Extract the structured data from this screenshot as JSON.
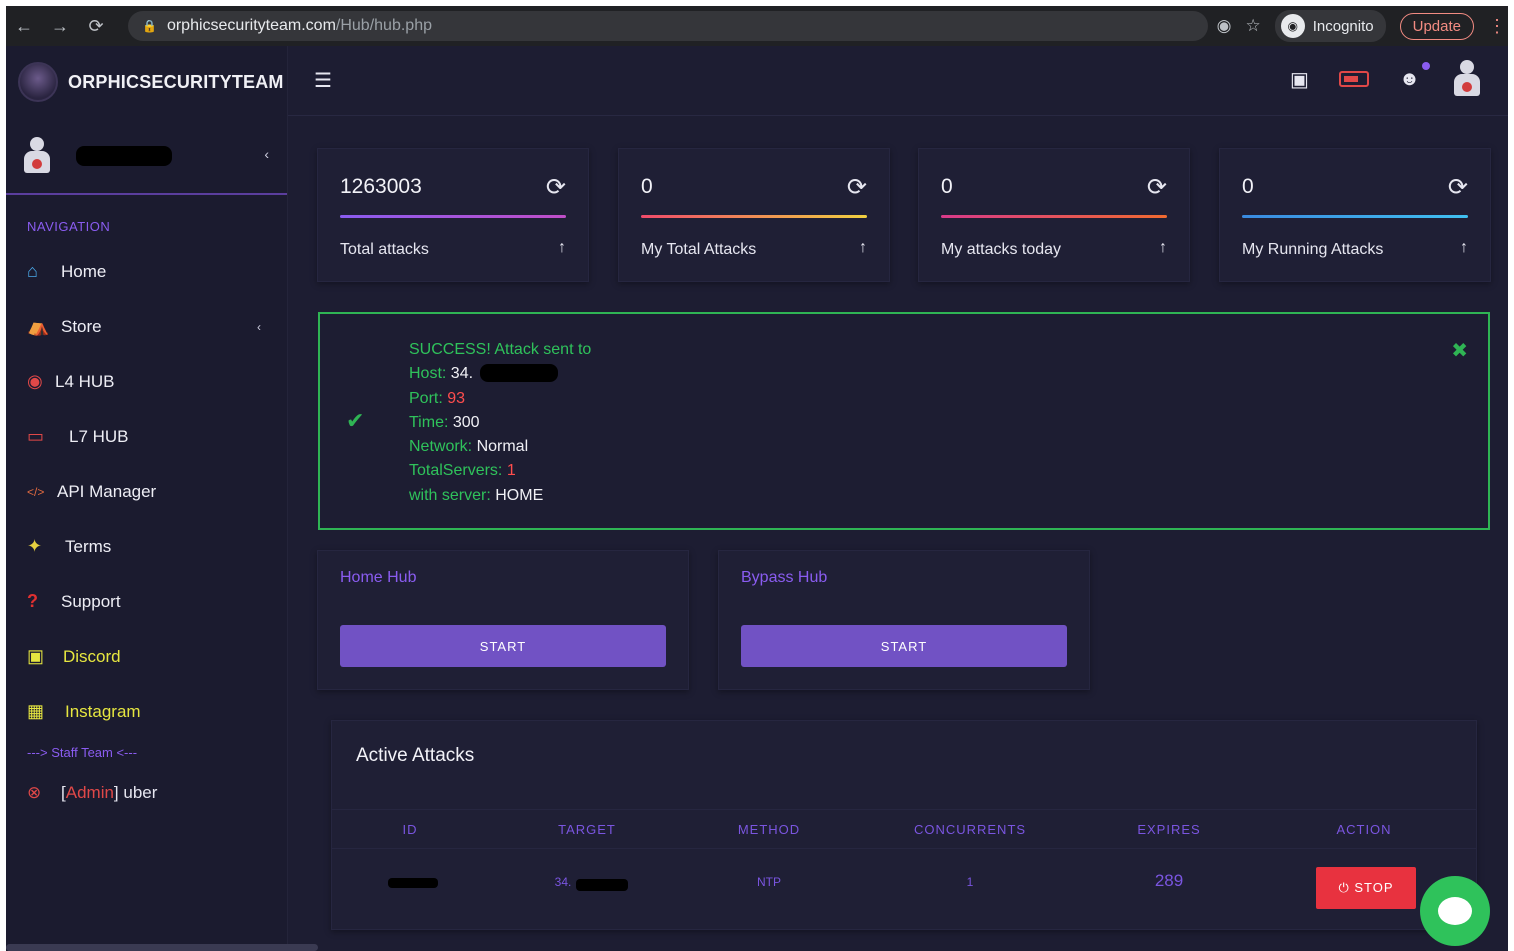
{
  "browser": {
    "url_host": "orphicsecurityteam.com",
    "url_path": "/Hub/hub.php",
    "profile_label": "Incognito",
    "update_label": "Update"
  },
  "brand": {
    "name": "ORPHICSECURITYTEAM"
  },
  "sidebar": {
    "nav_title": "NAVIGATION",
    "items": [
      {
        "label": "Home",
        "icon": "home-icon",
        "color": "#eeeef5"
      },
      {
        "label": "Store",
        "icon": "basket-icon",
        "color": "#eeeef5"
      },
      {
        "label": "L4 HUB",
        "icon": "fire-icon",
        "color": "#eeeef5"
      },
      {
        "label": "L7 HUB",
        "icon": "battery-icon",
        "color": "#eeeef5"
      },
      {
        "label": "API Manager",
        "icon": "code-icon",
        "color": "#eeeef5"
      },
      {
        "label": "Terms",
        "icon": "magic-icon",
        "color": "#eeeef5"
      },
      {
        "label": "Support",
        "icon": "question-icon",
        "color": "#eeeef5"
      },
      {
        "label": "Discord",
        "icon": "discord-icon",
        "color": "#e6e640"
      },
      {
        "label": "Instagram",
        "icon": "gift-icon",
        "color": "#e6e640"
      }
    ],
    "staff_title": "---> Staff Team <---",
    "admin": {
      "tag": "Admin",
      "name": " uber"
    }
  },
  "stats": [
    {
      "value": "1263003",
      "label": "Total attacks",
      "bar": "linear-gradient(90deg,#8a5cf0,#c04ec8)"
    },
    {
      "value": "0",
      "label": "My Total Attacks",
      "bar": "linear-gradient(90deg,#f04a6a,#f0d040)"
    },
    {
      "value": "0",
      "label": "My attacks today",
      "bar": "linear-gradient(90deg,#d83a8a,#f06a30)"
    },
    {
      "value": "0",
      "label": "My Running Attacks",
      "bar": "linear-gradient(90deg,#3a8ae0,#40c0f0)"
    }
  ],
  "alert": {
    "line1": "SUCCESS! Attack sent to",
    "host_label": "Host:",
    "host_value": " 34.",
    "port_label": "Port:",
    "port_value": " 93",
    "time_label": "Time:",
    "time_value": " 300",
    "network_label": "Network:",
    "network_value": " Normal",
    "servers_label": "TotalServers:",
    "servers_value": " 1",
    "server_label": "with server:",
    "server_value": " HOME"
  },
  "hubs": [
    {
      "title": "Home Hub",
      "button": "START"
    },
    {
      "title": "Bypass Hub",
      "button": "START"
    }
  ],
  "active": {
    "title": "Active Attacks",
    "columns": [
      "ID",
      "TARGET",
      "METHOD",
      "CONCURRENTS",
      "EXPIRES",
      "ACTION"
    ],
    "row": {
      "target": "34.",
      "method": "NTP",
      "concurrents": "1",
      "expires": "289",
      "action": "STOP"
    }
  }
}
